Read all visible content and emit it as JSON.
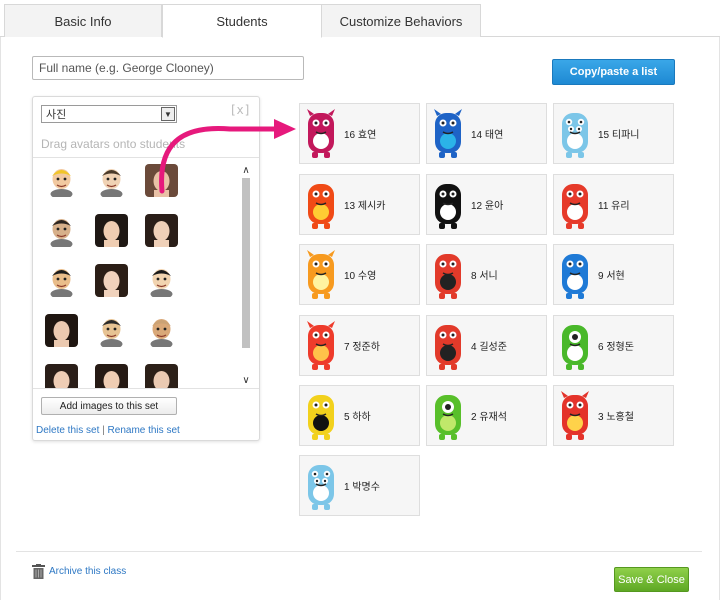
{
  "tabs": [
    {
      "label": "Basic Info"
    },
    {
      "label": "Students"
    },
    {
      "label": "Customize Behaviors"
    }
  ],
  "name_input": {
    "placeholder": "Full name (e.g. George Clooney)",
    "value": ""
  },
  "paste_button": {
    "label": "Copy/paste a list"
  },
  "avatar_panel": {
    "set_select": "사진",
    "close_label": "[x]",
    "hint": "Drag avatars onto students",
    "add_images_label": "Add images to this set",
    "delete_link": "Delete this set",
    "separator": "|",
    "rename_link": "Rename this set",
    "avatars": [
      {
        "kind": "cartoon",
        "skin": "#f2c9a0",
        "hair": "#f0c52a"
      },
      {
        "kind": "cartoon",
        "skin": "#f0d2b4",
        "hair": "#4a3a2a"
      },
      {
        "kind": "photo",
        "skin": "#e9c1a6",
        "hair": "#6b4a3a"
      },
      {
        "kind": "cartoon",
        "skin": "#d7b08a",
        "hair": "#2c2520"
      },
      {
        "kind": "photo",
        "skin": "#efcdb2",
        "hair": "#1f1814"
      },
      {
        "kind": "photo",
        "skin": "#efd0b8",
        "hair": "#2a1e18"
      },
      {
        "kind": "cartoon",
        "skin": "#e9bd8a",
        "hair": "#1c1c1c"
      },
      {
        "kind": "photo",
        "skin": "#f0d2bc",
        "hair": "#2b1e16"
      },
      {
        "kind": "cartoon",
        "skin": "#f2d4b0",
        "hair": "#1a1a1a"
      },
      {
        "kind": "photo",
        "skin": "#ebc9b0",
        "hair": "#1f1611"
      },
      {
        "kind": "cartoon",
        "skin": "#e7c393",
        "hair": "#2a2a2a"
      },
      {
        "kind": "cartoon",
        "skin": "#d9a878",
        "hair": "#caa275"
      },
      {
        "kind": "photo",
        "skin": "#eecdb5",
        "hair": "#2a1e18"
      },
      {
        "kind": "photo",
        "skin": "#efcdb3",
        "hair": "#261a14"
      },
      {
        "kind": "photo",
        "skin": "#eacab2",
        "hair": "#2c2018"
      }
    ]
  },
  "students": [
    {
      "name": "16 효연",
      "monster": {
        "color": "#c2185b",
        "belly": "#ffffff",
        "horns": true,
        "eyes": 2
      }
    },
    {
      "name": "14 태연",
      "monster": {
        "color": "#1e63c6",
        "belly": "#2bb3e8",
        "horns": true,
        "eyes": 2
      }
    },
    {
      "name": "15 티파니",
      "monster": {
        "color": "#7cc6e8",
        "belly": "#ffffff",
        "horns": false,
        "eyes": 4
      }
    },
    {
      "name": "13 제시카",
      "monster": {
        "color": "#f04a16",
        "belly": "#ffcc33",
        "horns": false,
        "eyes": 2
      }
    },
    {
      "name": "12 윤아",
      "monster": {
        "color": "#111111",
        "belly": "#ffffff",
        "horns": false,
        "eyes": 2
      }
    },
    {
      "name": "11 유리",
      "monster": {
        "color": "#e63a2a",
        "belly": "#ffffff",
        "horns": false,
        "eyes": 2
      }
    },
    {
      "name": "10 수영",
      "monster": {
        "color": "#f79a1f",
        "belly": "#fff3a0",
        "horns": true,
        "eyes": 2
      }
    },
    {
      "name": "8 서니",
      "monster": {
        "color": "#e23a2a",
        "belly": "#222222",
        "horns": false,
        "eyes": 2
      }
    },
    {
      "name": "9 서현",
      "monster": {
        "color": "#1f7ad6",
        "belly": "#ffffff",
        "horns": false,
        "eyes": 2
      }
    },
    {
      "name": "7 정준하",
      "monster": {
        "color": "#ee3b2b",
        "belly": "#ffc24a",
        "horns": true,
        "eyes": 2
      }
    },
    {
      "name": "4 길성준",
      "monster": {
        "color": "#e23a2a",
        "belly": "#222222",
        "horns": false,
        "eyes": 2
      }
    },
    {
      "name": "6 정형돈",
      "monster": {
        "color": "#49b82a",
        "belly": "#ffffff",
        "horns": false,
        "eyes": 1
      }
    },
    {
      "name": "5 하하",
      "monster": {
        "color": "#f2d11c",
        "belly": "#111111",
        "horns": false,
        "eyes": 2
      }
    },
    {
      "name": "2 유재석",
      "monster": {
        "color": "#58bf2a",
        "belly": "#c0e86a",
        "horns": false,
        "eyes": 1
      }
    },
    {
      "name": "3 노홍철",
      "monster": {
        "color": "#e4332a",
        "belly": "#ffd24a",
        "horns": true,
        "eyes": 2
      }
    },
    {
      "name": "1 박명수",
      "monster": {
        "color": "#7cc6e8",
        "belly": "#ffffff",
        "horns": false,
        "eyes": 4
      }
    }
  ],
  "footer": {
    "archive_label": "Archive this class",
    "save_label": "Save & Close"
  },
  "colors": {
    "paste_button": "#1e89d3",
    "save_button": "#6cb52c",
    "link": "#2e78c4",
    "drag_arrow": "#e6197c"
  }
}
